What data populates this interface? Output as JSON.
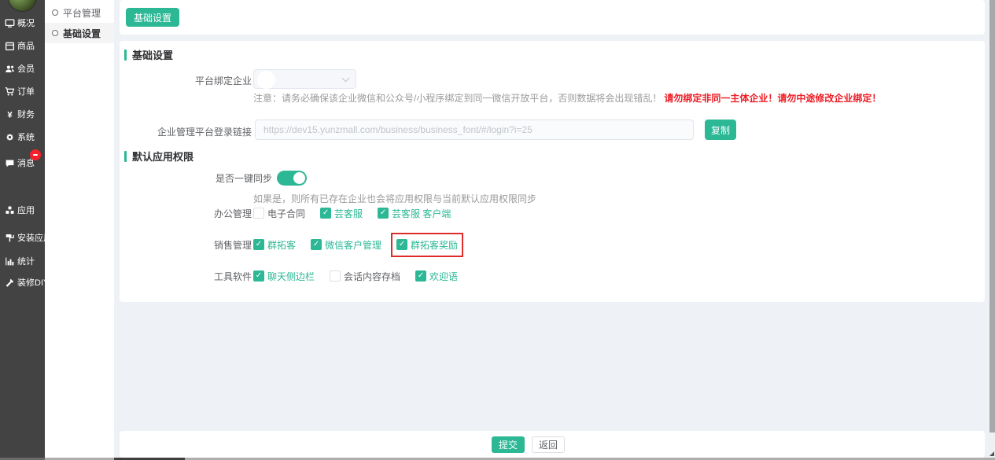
{
  "colors": {
    "accent": "#2cb795",
    "sidebar_bg": "#434343",
    "page_bg": "#eef1f5",
    "warning_red": "#ed1c24",
    "highlight_box_red": "#e02b2b",
    "badge_red": "#f5222d"
  },
  "sidebar": {
    "items": [
      {
        "id": "overview",
        "icon": "overview-icon",
        "label": "概况"
      },
      {
        "id": "goods",
        "icon": "goods-icon",
        "label": "商品"
      },
      {
        "id": "members",
        "icon": "members-icon",
        "label": "会员"
      },
      {
        "id": "orders",
        "icon": "cart-icon",
        "label": "订单"
      },
      {
        "id": "finance",
        "icon": "yen-icon",
        "label": "财务"
      },
      {
        "id": "system",
        "icon": "gear-icon",
        "label": "系统"
      },
      {
        "id": "messages",
        "icon": "chat-icon",
        "label": "消息",
        "badge": "-"
      },
      {
        "id": "apps",
        "icon": "apps-icon",
        "label": "应用"
      },
      {
        "id": "install-app",
        "icon": "roller-icon",
        "label": "安装应用"
      },
      {
        "id": "stats",
        "icon": "bar-chart-icon",
        "label": "统计"
      },
      {
        "id": "decorate-diy",
        "icon": "hammer-icon",
        "label": "装修DIY"
      }
    ]
  },
  "submenu": {
    "items": [
      {
        "label": "平台管理",
        "active": false
      },
      {
        "label": "基础设置",
        "active": true
      }
    ]
  },
  "toolbar": {
    "tab_label": "基础设置"
  },
  "main": {
    "section1_title": "基础设置",
    "section2_title": "默认应用权限",
    "bind_company": {
      "label": "平台绑定企业",
      "note_gray": "注意：请务必确保该企业微信和公众号/小程序绑定到同一微信开放平台，否则数据将会出现错乱！",
      "note_red": "请勿绑定非同一主体企业！请勿中途修改企业绑定！"
    },
    "login_link": {
      "label": "企业管理平台登录链接",
      "value": "https://dev15.yunzmall.com/business/business_font/#/login?i=25",
      "copy_label": "复制"
    },
    "sync": {
      "label": "是否一键同步",
      "on": true,
      "help": "如果是，则所有已存在企业也会将应用权限与当前默认应用权限同步"
    },
    "permission_groups": [
      {
        "label": "办公管理",
        "options": [
          {
            "label": "电子合同",
            "checked": false
          },
          {
            "label": "芸客服",
            "checked": true
          },
          {
            "label": "芸客服 客户端",
            "checked": true
          }
        ]
      },
      {
        "label": "销售管理",
        "options": [
          {
            "label": "群拓客",
            "checked": true
          },
          {
            "label": "微信客户管理",
            "checked": true
          },
          {
            "label": "群拓客奖励",
            "checked": true,
            "highlighted": true
          }
        ]
      },
      {
        "label": "工具软件",
        "options": [
          {
            "label": "聊天侧边栏",
            "checked": true
          },
          {
            "label": "会话内容存档",
            "checked": false
          },
          {
            "label": "欢迎语",
            "checked": true
          }
        ]
      }
    ]
  },
  "footer": {
    "submit_label": "提交",
    "back_label": "返回"
  }
}
